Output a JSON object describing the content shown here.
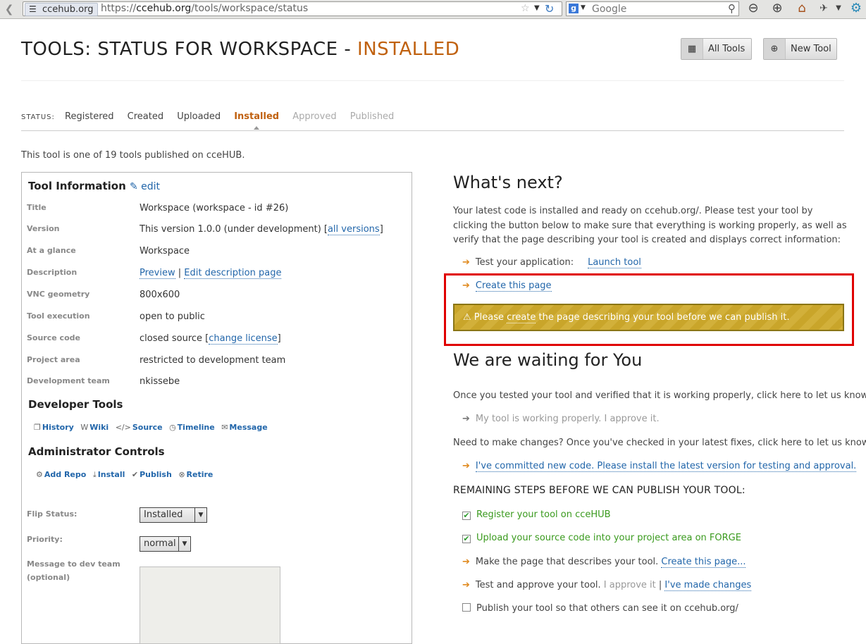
{
  "browser": {
    "site_label": "ccehub.org",
    "url_prefix": "https://",
    "url_host": "ccehub.org",
    "url_path": "/tools/workspace/status",
    "search_placeholder": "Google"
  },
  "header": {
    "title_prefix": "TOOLS: STATUS FOR WORKSPACE - ",
    "title_status": "INSTALLED",
    "all_tools_label": "All Tools",
    "new_tool_label": "New Tool"
  },
  "status_bar": {
    "label": "STATUS:",
    "steps": [
      "Registered",
      "Created",
      "Uploaded",
      "Installed",
      "Approved",
      "Published"
    ],
    "active_step": "Installed"
  },
  "intro": "This tool is one of 19 tools published on cceHUB.",
  "tool_info": {
    "heading": "Tool Information",
    "edit_label": "✎ edit",
    "rows": [
      {
        "label": "Title",
        "value": "Workspace (workspace - id #26)"
      },
      {
        "label": "Version",
        "value": "This version 1.0.0 (under development) [",
        "link": "all versions",
        "suffix": "]"
      },
      {
        "label": "At a glance",
        "value": "Workspace"
      },
      {
        "label": "Description",
        "link1": "Preview",
        "sep": " | ",
        "link2": "Edit description page"
      },
      {
        "label": "VNC geometry",
        "value": "800x600"
      },
      {
        "label": "Tool execution",
        "value": "open to public"
      },
      {
        "label": "Source code",
        "value": "closed source [",
        "link": "change license",
        "suffix": "]"
      },
      {
        "label": "Project area",
        "value": "restricted to development team"
      },
      {
        "label": "Development team",
        "value": "nkissebe"
      }
    ]
  },
  "developer_tools": {
    "heading": "Developer Tools",
    "links": [
      "History",
      "Wiki",
      "Source",
      "Timeline",
      "Message"
    ]
  },
  "admin_controls": {
    "heading": "Administrator Controls",
    "links": [
      "Add Repo",
      "Install",
      "Publish",
      "Retire"
    ],
    "flip_status_label": "Flip Status:",
    "flip_status_value": "Installed",
    "priority_label": "Priority:",
    "priority_value": "normal",
    "message_label_line1": "Message to dev team",
    "message_label_line2": "(optional)"
  },
  "whats_next": {
    "heading": "What's next?",
    "text": "Your latest code is installed and ready on ccehub.org/. Please test your tool by clicking the button below to make sure that everything is working properly, as well as verify that the page describing your tool is created and displays correct information:",
    "test_label": "Test your application:",
    "launch_label": "Launch tool",
    "create_page_label": "Create this page",
    "warning_prefix": "⚠ Please ",
    "warning_link": "create",
    "warning_suffix": " the page describing your tool before we can publish it."
  },
  "waiting": {
    "heading": "We are waiting for You",
    "tested_text": "Once you tested your tool and verified that it is working properly, click here to let us know:",
    "approve_label": "My tool is working properly. I approve it.",
    "changes_text": "Need to make changes? Once you've checked in your latest fixes, click here to let us know:",
    "committed_label": "I've committed new code. Please install the latest version for testing and approval.",
    "remaining_heading": "REMAINING STEPS BEFORE WE CAN PUBLISH YOUR TOOL:",
    "steps": {
      "register": "Register your tool on cceHUB",
      "upload": "Upload your source code into your project area on FORGE",
      "make_page": "Make the page that describes your tool. ",
      "make_page_link": "Create this page...",
      "test_approve": "Test and approve your tool. ",
      "approve_it": "I approve it",
      "sep": " | ",
      "made_changes": "I've made changes",
      "publish": "Publish your tool so that others can see it on ccehub.org/"
    }
  },
  "colors": {
    "accent": "#c0610f",
    "link": "#2266aa",
    "warning": "#c9a52a",
    "highlight": "#e00000",
    "done": "#3a9a1e"
  }
}
